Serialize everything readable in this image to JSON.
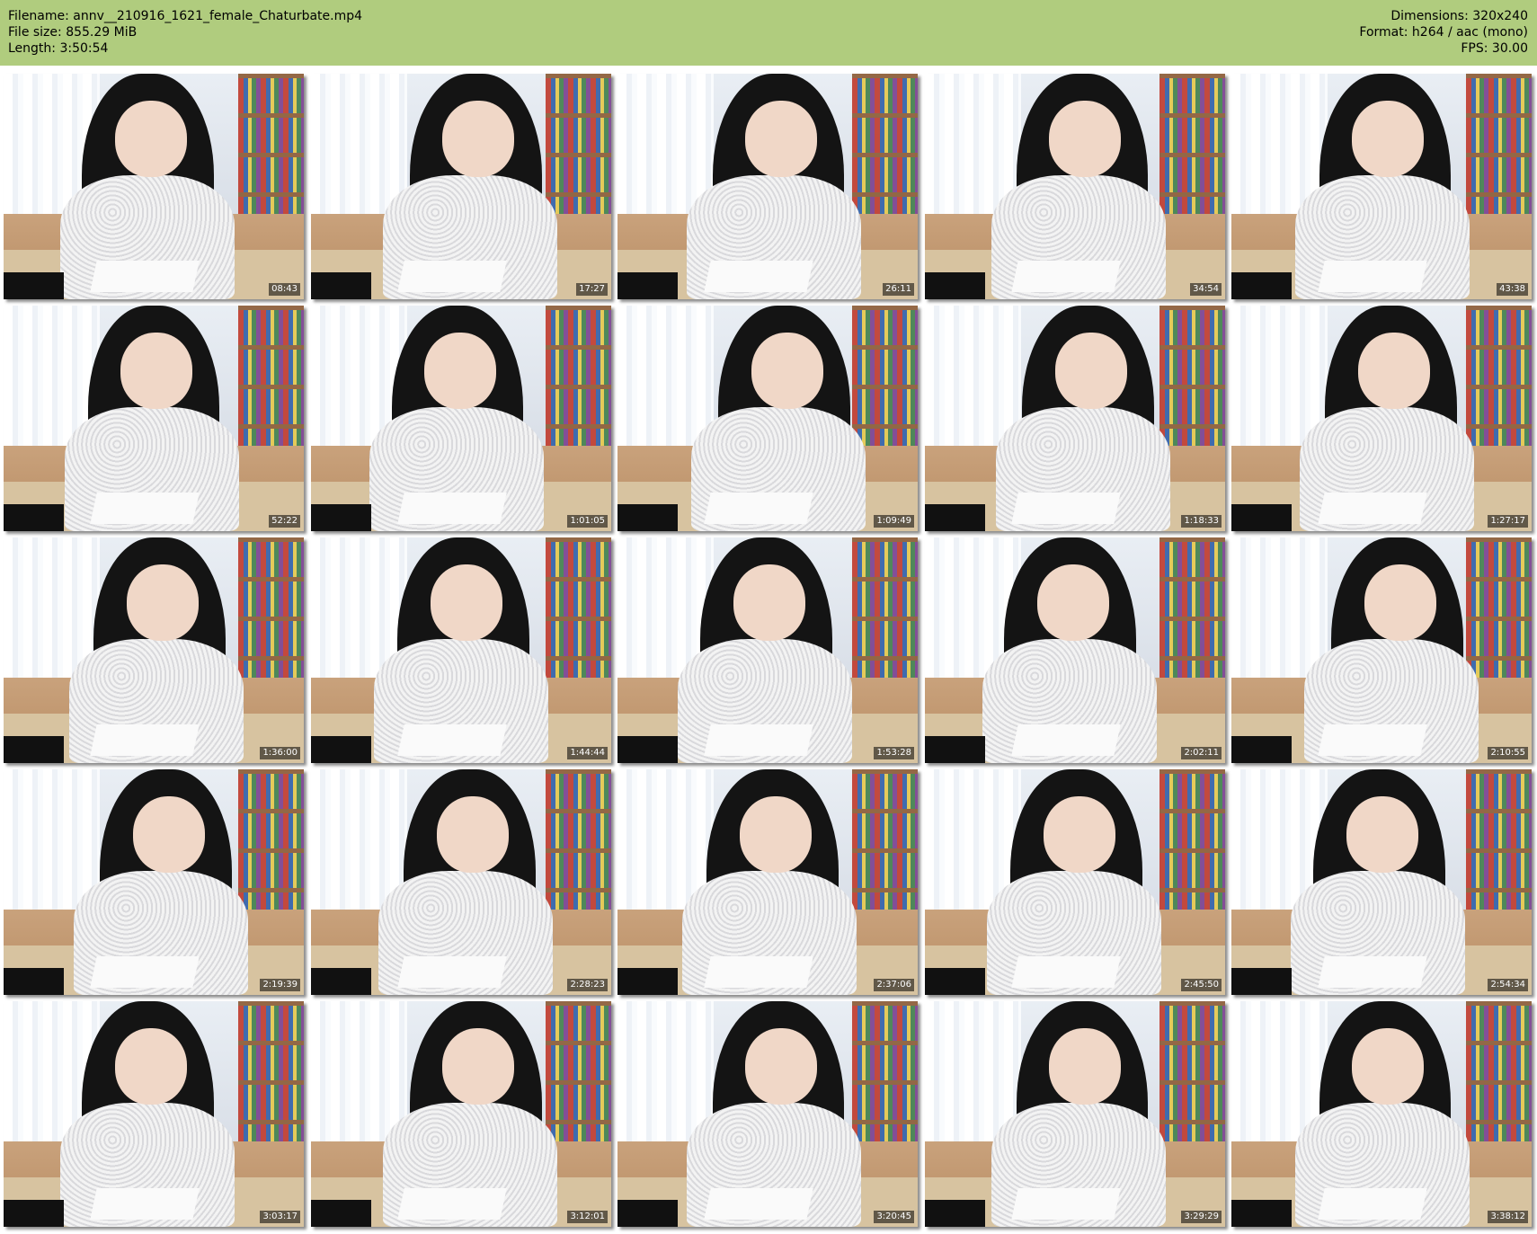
{
  "header": {
    "filename": "Filename: annv__210916_1621_female_Chaturbate.mp4",
    "file_size": "File size: 855.29 MiB",
    "length": "Length: 3:50:54",
    "dimensions": "Dimensions: 320x240",
    "format": "Format: h264 / aac (mono)",
    "fps": "FPS: 30.00",
    "background_color": "#b0cc7e"
  },
  "thumbnails": [
    {
      "timestamp": "08:43"
    },
    {
      "timestamp": "17:27"
    },
    {
      "timestamp": "26:11"
    },
    {
      "timestamp": "34:54"
    },
    {
      "timestamp": "43:38"
    },
    {
      "timestamp": "52:22"
    },
    {
      "timestamp": "1:01:05"
    },
    {
      "timestamp": "1:09:49"
    },
    {
      "timestamp": "1:18:33"
    },
    {
      "timestamp": "1:27:17"
    },
    {
      "timestamp": "1:36:00"
    },
    {
      "timestamp": "1:44:44"
    },
    {
      "timestamp": "1:53:28"
    },
    {
      "timestamp": "2:02:11"
    },
    {
      "timestamp": "2:10:55"
    },
    {
      "timestamp": "2:19:39"
    },
    {
      "timestamp": "2:28:23"
    },
    {
      "timestamp": "2:37:06"
    },
    {
      "timestamp": "2:45:50"
    },
    {
      "timestamp": "2:54:34"
    },
    {
      "timestamp": "3:03:17"
    },
    {
      "timestamp": "3:12:01"
    },
    {
      "timestamp": "3:20:45"
    },
    {
      "timestamp": "3:29:29"
    },
    {
      "timestamp": "3:38:12"
    }
  ]
}
